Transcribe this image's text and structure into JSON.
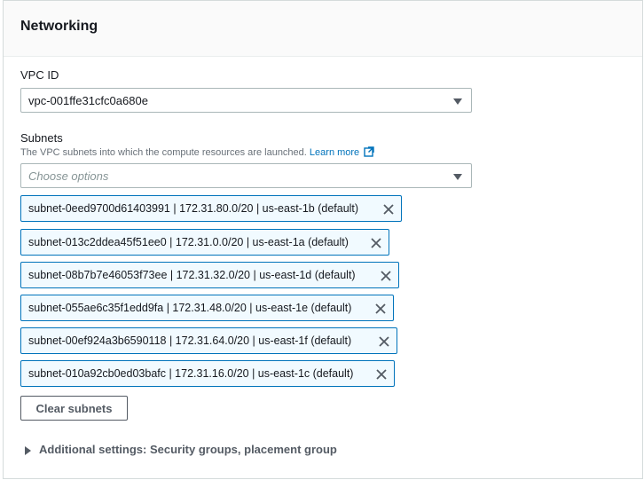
{
  "panel": {
    "title": "Networking"
  },
  "vpc": {
    "label": "VPC ID",
    "value": "vpc-001ffe31cfc0a680e",
    "caret_icon": "caret-down-icon"
  },
  "subnets": {
    "label": "Subnets",
    "description": "The VPC subnets into which the compute resources are launched.",
    "learn_more": "Learn more",
    "learn_more_icon": "external-link-icon",
    "placeholder": "Choose options",
    "selected": [
      "subnet-0eed9700d61403991 | 172.31.80.0/20 | us-east-1b (default)",
      "subnet-013c2ddea45f51ee0 | 172.31.0.0/20 | us-east-1a (default)",
      "subnet-08b7b7e46053f73ee | 172.31.32.0/20 | us-east-1d (default)",
      "subnet-055ae6c35f1edd9fa | 172.31.48.0/20 | us-east-1e (default)",
      "subnet-00ef924a3b6590118 | 172.31.64.0/20 | us-east-1f (default)",
      "subnet-010a92cb0ed03bafc | 172.31.16.0/20 | us-east-1c (default)"
    ],
    "remove_icon": "close-icon",
    "clear_button": "Clear subnets"
  },
  "additional": {
    "label": "Additional settings: Security groups, placement group",
    "icon": "caret-right-icon"
  },
  "colors": {
    "accent": "#0073bb",
    "token_bg": "#f1faff",
    "text": "#16191f",
    "muted": "#687078"
  }
}
